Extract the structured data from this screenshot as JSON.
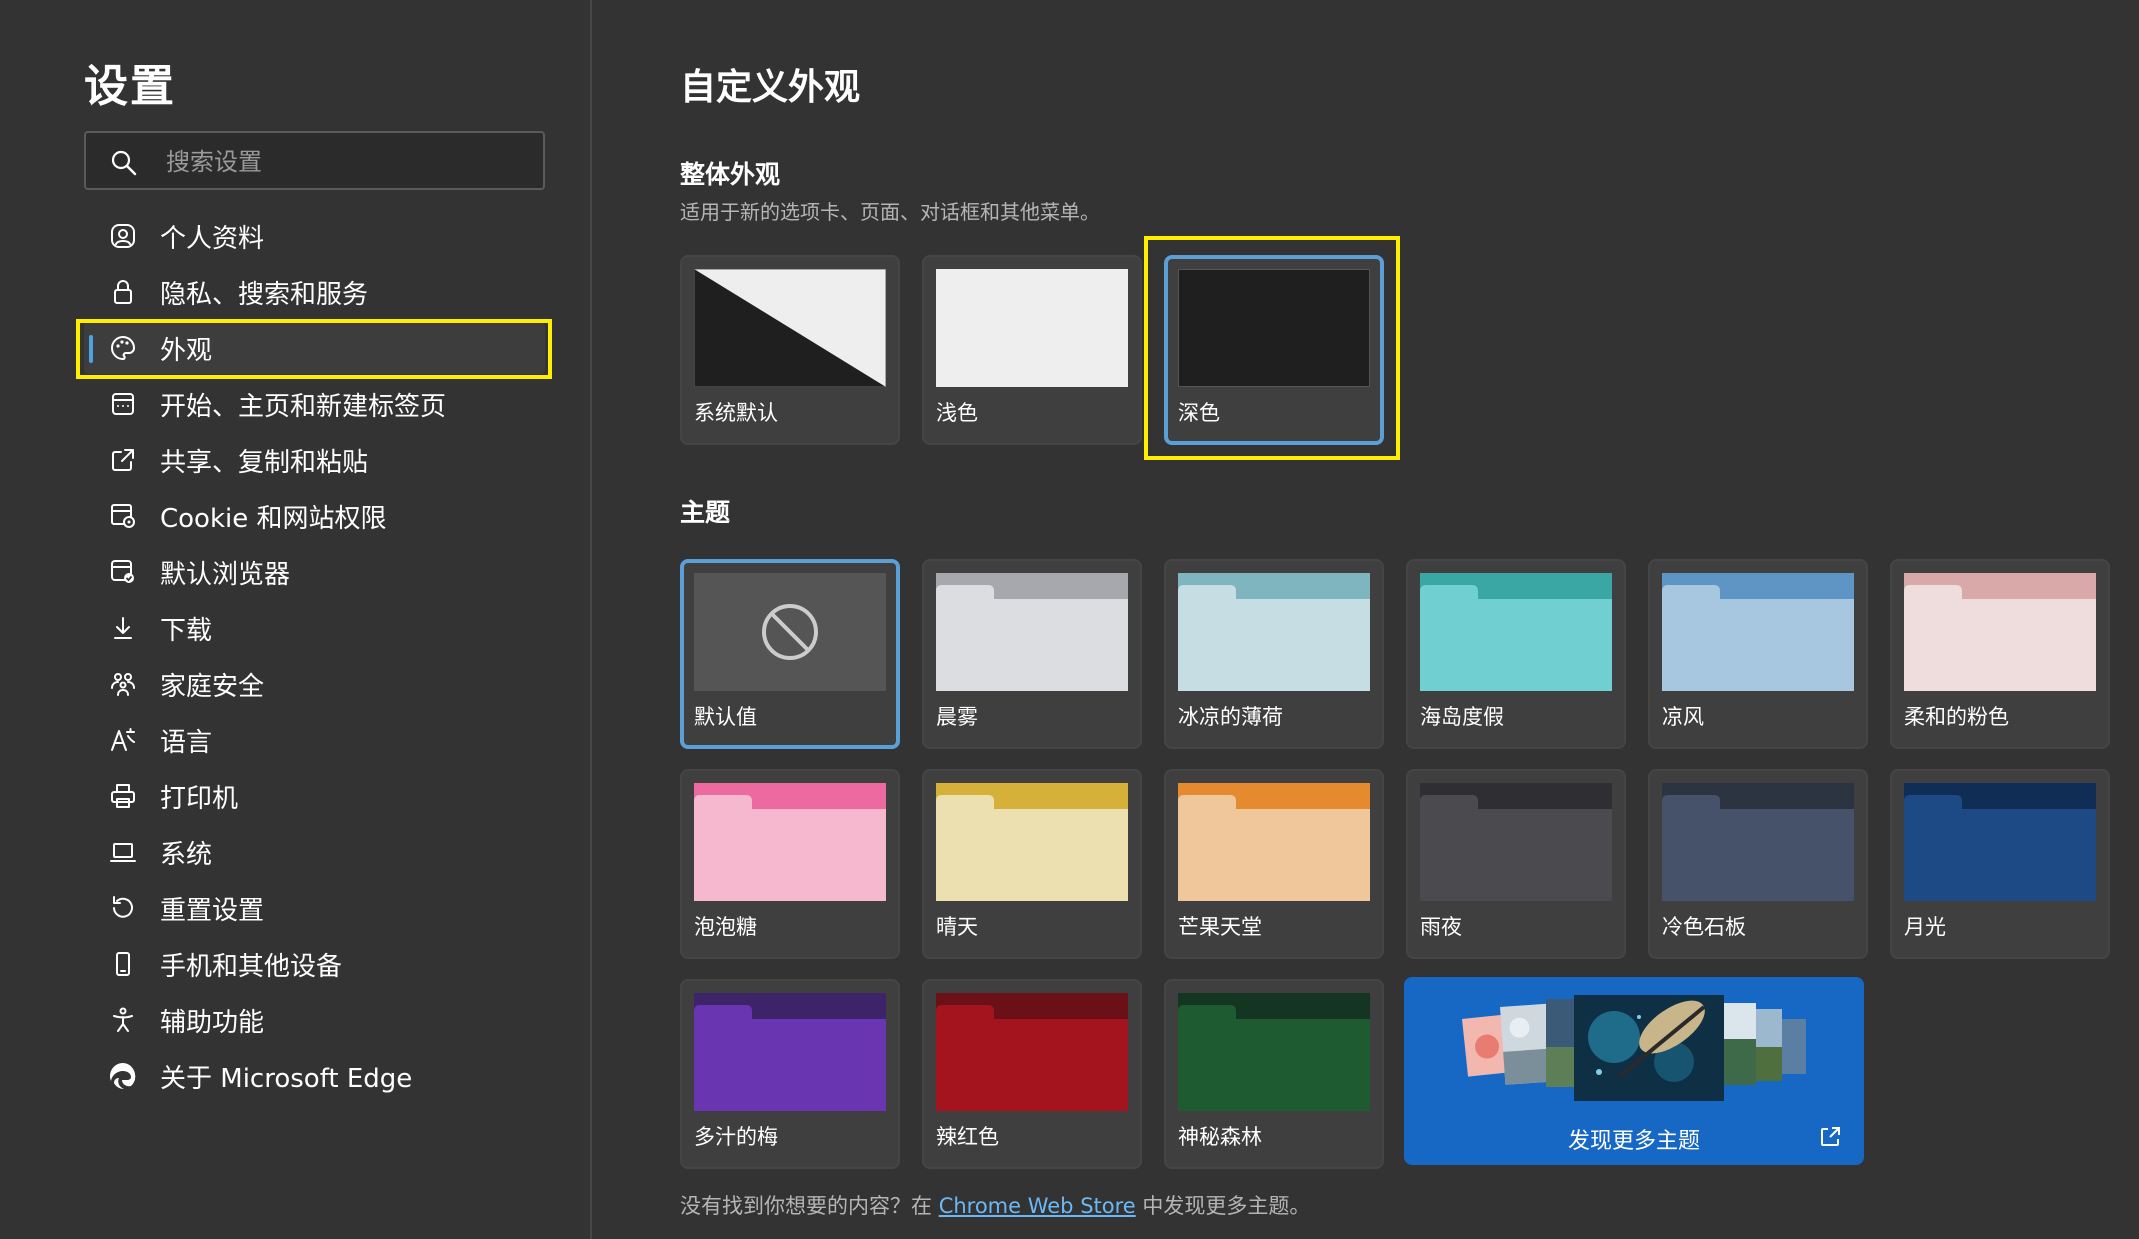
{
  "sidebar": {
    "title": "设置",
    "search_placeholder": "搜索设置",
    "items": [
      {
        "label": "个人资料",
        "icon": "profile-icon"
      },
      {
        "label": "隐私、搜索和服务",
        "icon": "lock-icon"
      },
      {
        "label": "外观",
        "icon": "palette-icon",
        "active": true
      },
      {
        "label": "开始、主页和新建标签页",
        "icon": "home-tab-icon"
      },
      {
        "label": "共享、复制和粘贴",
        "icon": "share-icon"
      },
      {
        "label": "Cookie 和网站权限",
        "icon": "cookie-icon"
      },
      {
        "label": "默认浏览器",
        "icon": "browser-icon"
      },
      {
        "label": "下载",
        "icon": "download-icon"
      },
      {
        "label": "家庭安全",
        "icon": "family-icon"
      },
      {
        "label": "语言",
        "icon": "language-icon"
      },
      {
        "label": "打印机",
        "icon": "printer-icon"
      },
      {
        "label": "系统",
        "icon": "laptop-icon"
      },
      {
        "label": "重置设置",
        "icon": "reset-icon"
      },
      {
        "label": "手机和其他设备",
        "icon": "phone-icon"
      },
      {
        "label": "辅助功能",
        "icon": "accessibility-icon"
      },
      {
        "label": "关于 Microsoft Edge",
        "icon": "edge-logo-icon"
      }
    ]
  },
  "main": {
    "title": "自定义外观",
    "overall": {
      "heading": "整体外观",
      "subtitle": "适用于新的选项卡、页面、对话框和其他菜单。",
      "options": [
        {
          "label": "系统默认",
          "style": "system"
        },
        {
          "label": "浅色",
          "style": "light"
        },
        {
          "label": "深色",
          "style": "dark",
          "selected": true
        }
      ]
    },
    "themes": {
      "heading": "主题",
      "items": [
        {
          "label": "默认值",
          "tab": "",
          "body": "",
          "selected": true
        },
        {
          "label": "晨雾",
          "tab": "#a6a8ad",
          "body": "#dcdde1"
        },
        {
          "label": "冰凉的薄荷",
          "tab": "#7fb5bf",
          "body": "#c5dde3"
        },
        {
          "label": "海岛度假",
          "tab": "#3aa7a5",
          "body": "#6fcfd1"
        },
        {
          "label": "凉风",
          "tab": "#5f95c4",
          "body": "#a7c6e0"
        },
        {
          "label": "柔和的粉色",
          "tab": "#d9a8a9",
          "body": "#efdcdc"
        },
        {
          "label": "泡泡糖",
          "tab": "#ec6aa0",
          "body": "#f6b8cf"
        },
        {
          "label": "晴天",
          "tab": "#d6b13a",
          "body": "#ecdfb0"
        },
        {
          "label": "芒果天堂",
          "tab": "#e68a30",
          "body": "#f0c79a"
        },
        {
          "label": "雨夜",
          "tab": "#2f2f33",
          "body": "#4b4b4f"
        },
        {
          "label": "冷色石板",
          "tab": "#2c3442",
          "body": "#45526a"
        },
        {
          "label": "月光",
          "tab": "#0f2d55",
          "body": "#1d4a85"
        },
        {
          "label": "多汁的梅",
          "tab": "#3d2367",
          "body": "#6a35b0"
        },
        {
          "label": "辣红色",
          "tab": "#6a1016",
          "body": "#a4141f"
        },
        {
          "label": "神秘森林",
          "tab": "#143521",
          "body": "#1e5b30"
        }
      ],
      "discover_label": "发现更多主题"
    },
    "footer": {
      "before": "没有找到你想要的内容？在 ",
      "link": "Chrome Web Store",
      "after": " 中发现更多主题。"
    }
  },
  "colors": {
    "accent": "#4ba3e3",
    "highlight": "#ffee00",
    "link": "#6cb8f6",
    "discover_bg": "#1668c4"
  }
}
